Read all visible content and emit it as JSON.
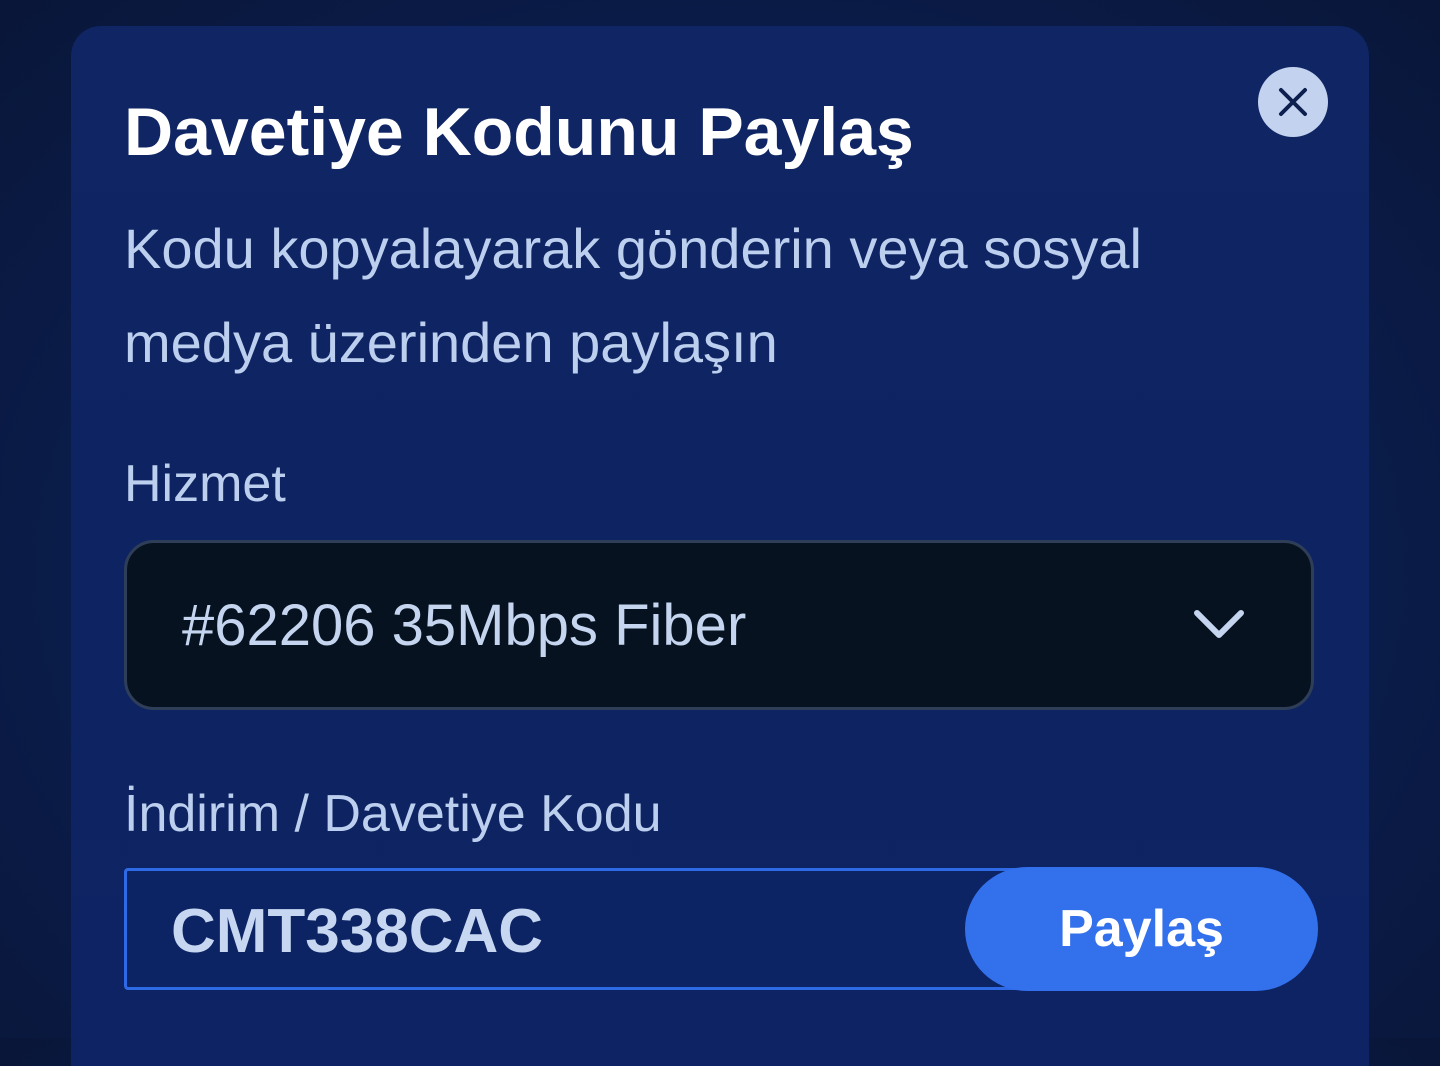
{
  "modal": {
    "title": "Davetiye Kodunu Paylaş",
    "subtitle": "Kodu kopyalayarak gönderin veya sosyal medya üzerinden paylaşın",
    "close_icon": "close-icon"
  },
  "service_field": {
    "label": "Hizmet",
    "selected_value": "#62206 35Mbps Fiber",
    "icon": "chevron-down-icon"
  },
  "code_field": {
    "label": "İndirim / Davetiye Kodu",
    "value": "CMT338CAC",
    "share_button_label": "Paylaş"
  },
  "colors": {
    "background": "#0b1f52",
    "modal": "#0e2462",
    "accent": "#3370ec",
    "text_muted": "#bccfee",
    "select_background": "#06121f",
    "close_button": "#c3d2ee"
  }
}
